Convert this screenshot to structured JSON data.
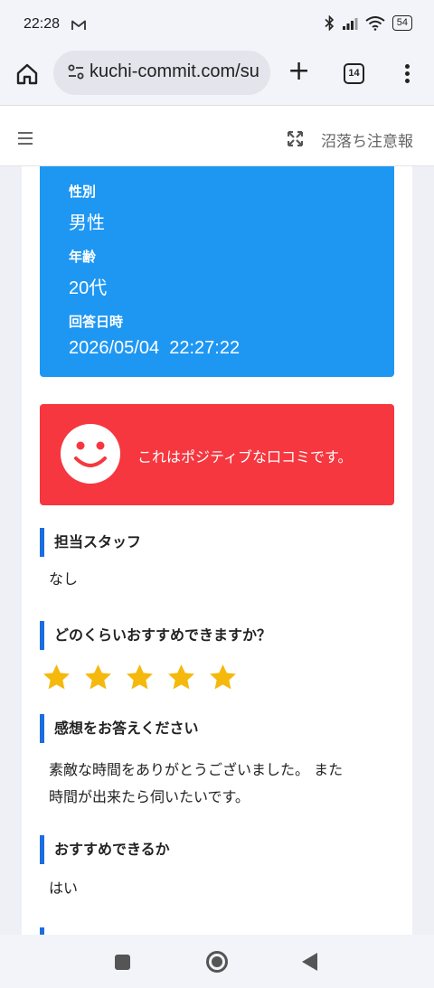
{
  "status_bar": {
    "time": "22:28",
    "mail_icon": "gmail-icon",
    "battery": "54",
    "icons": [
      "bluetooth-icon",
      "signal-icon",
      "wifi-icon",
      "battery-icon"
    ]
  },
  "browser": {
    "url": "kuchi-commit.com/su",
    "tab_count": "14",
    "icons": [
      "home-icon",
      "site-info-icon",
      "plus-icon",
      "tabs-icon",
      "more-icon"
    ]
  },
  "site_header": {
    "title": "沼落ち注意報",
    "icons": [
      "hamburger-icon",
      "expand-icon"
    ]
  },
  "info_card": {
    "color": "#1e97f3",
    "gender_label": "性別",
    "gender_value": "男性",
    "age_label": "年齢",
    "age_value": "20代",
    "date_label": "回答日時",
    "date_value": "2026/05/04  22:27:22"
  },
  "positive_card": {
    "color": "#f6373f",
    "icon": "smiley-icon",
    "text": "これはポジティブな口コミです。"
  },
  "sections": [
    {
      "title": "担当スタッフ",
      "body": "なし"
    },
    {
      "title": "どのくらいおすすめできますか？",
      "rating": 5,
      "rating_max": 5,
      "star_color": "#f5b90d"
    },
    {
      "title": "感想をお答えください",
      "body_line1": "素敵な時間をありがとうございました。 また",
      "body_line2": "時間が出来たら伺いたいです。"
    },
    {
      "title": "おすすめできるか",
      "body": "はい"
    }
  ],
  "accent_color": "#1b6ee0",
  "bottom_nav": {
    "icons": [
      "recents-icon",
      "home-nav-icon",
      "back-icon"
    ]
  }
}
